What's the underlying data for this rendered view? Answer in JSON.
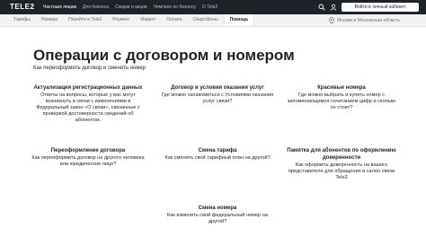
{
  "header": {
    "logo": "TELE2",
    "nav": [
      "Частным лицам",
      "Для бизнеса",
      "Скидки и акции",
      "Чемпион по бизнесу",
      "О Tele2"
    ],
    "login_button": "Войти в личный кабинет"
  },
  "subnav": {
    "items": [
      "Тарифы",
      "Номера",
      "Перейти в Tele2",
      "Роуминг",
      "Маркет",
      "Оплата",
      "Смартфоны",
      "Помощь"
    ],
    "active_index": 7,
    "region": "Москва и Московская область"
  },
  "page": {
    "title": "Операции с договором и номером",
    "subtitle": "Как переоформить договор и сменить номер"
  },
  "cards": [
    {
      "title": "Актуализация регистрационных данных",
      "body": "Ответы на вопросы, которые у вас могут возникнуть в связи с изменениями в Федеральный закон «О связи», связанные с проверкой достоверности сведений об абонентах."
    },
    {
      "title": "Договор и условия оказания услуг",
      "body": "Где можно ознакомиться с Условиями оказания услуг связи?"
    },
    {
      "title": "Красивые номера",
      "body": "Где можно выбрать и купить номер с запоминающимся сочетанием цифр и сколько он стоит?"
    },
    {
      "title": "Переоформление договора",
      "body": "Как переоформить договор на другого человека или юридическое лицо?"
    },
    {
      "title": "Смена тарифа",
      "body": "Как сменить свой тарифный план на другой?"
    },
    {
      "title": "Памятка для абонентов по оформлению доверенности",
      "body": "Как оформить доверенность на вашего представителя для обращения в салон связи Tele2"
    },
    {
      "title": "Смена номера",
      "body": "Как изменить свой федеральный номер на другой?"
    }
  ]
}
